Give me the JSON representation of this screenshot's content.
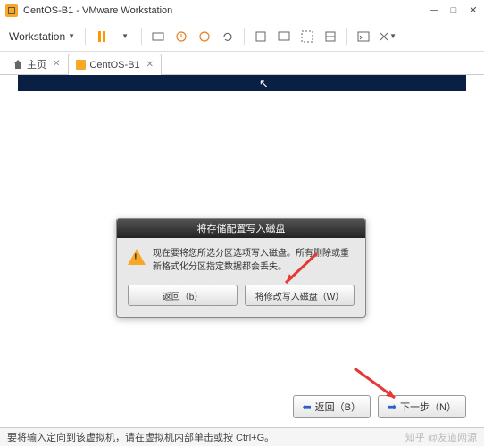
{
  "window": {
    "title": "CentOS-B1 - VMware Workstation"
  },
  "toolbar": {
    "menu_label": "Workstation"
  },
  "tabs": {
    "home": "主页",
    "vm": "CentOS-B1"
  },
  "dialog": {
    "title": "将存储配置写入磁盘",
    "message": "现在要将您所选分区选项写入磁盘。所有删除或重新格式化分区指定数据都会丢失。",
    "back_label": "返回（b）",
    "write_label": "将修改写入磁盘（W）"
  },
  "wizard": {
    "back": "返回（B）",
    "next": "下一步（N）"
  },
  "status": {
    "hint": "要将输入定向到该虚拟机，请在虚拟机内部单击或按 Ctrl+G。",
    "watermark": "知乎 @友道网源"
  }
}
